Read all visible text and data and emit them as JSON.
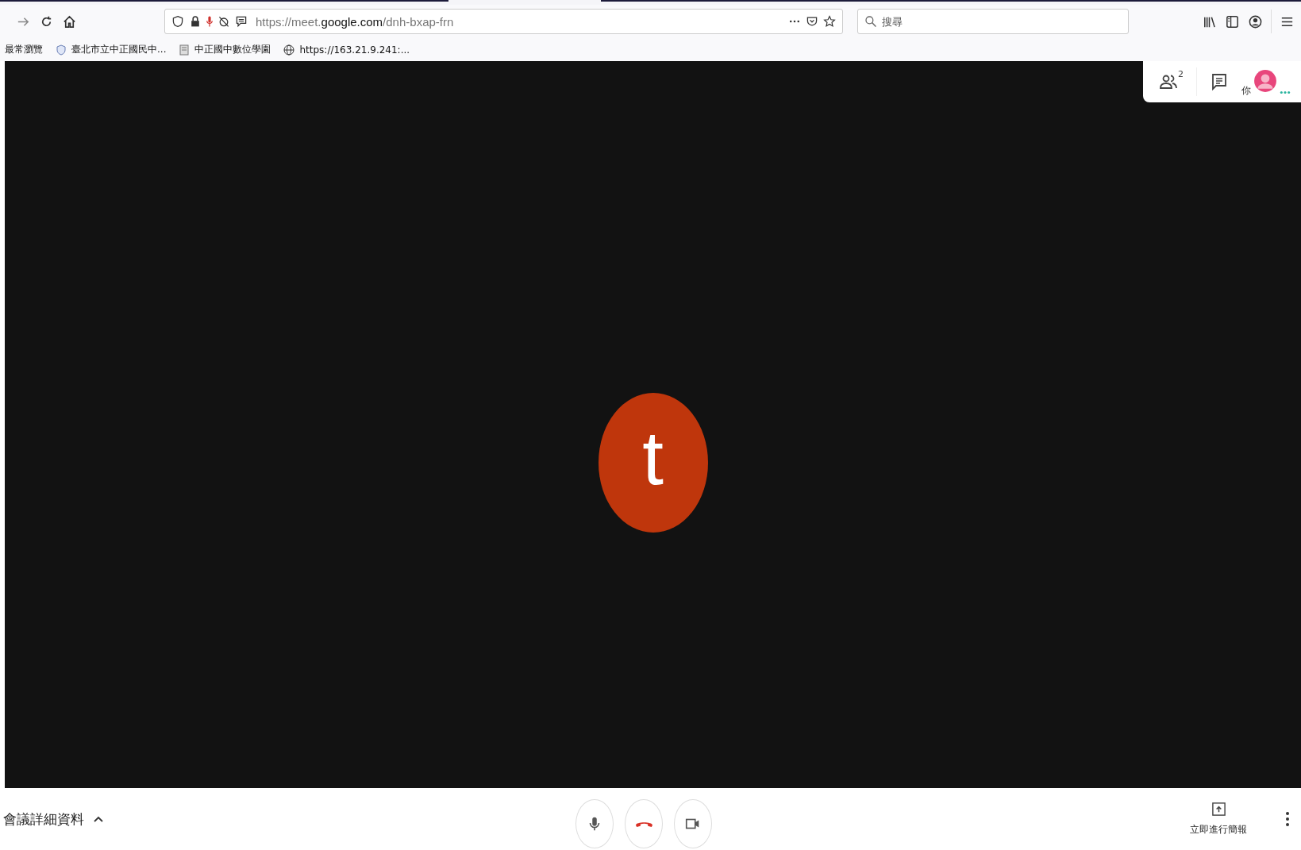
{
  "browser": {
    "url": {
      "before": "https://meet.",
      "domain": "google.com",
      "after": "/dnh-bxap-frn"
    },
    "search": {
      "placeholder": "搜尋"
    },
    "bookmarks": [
      {
        "label": "最常瀏覽",
        "kind": "folder"
      },
      {
        "label": "臺北市立中正國民中...",
        "kind": "shield"
      },
      {
        "label": "中正國中數位學園",
        "kind": "page"
      },
      {
        "label": "https://163.21.9.241:...",
        "kind": "globe"
      }
    ]
  },
  "meet": {
    "participants_count": "2",
    "self_label": "你",
    "avatar_letter": "t",
    "meeting_details": "會議詳細資料",
    "present_now": "立即進行簡報"
  }
}
